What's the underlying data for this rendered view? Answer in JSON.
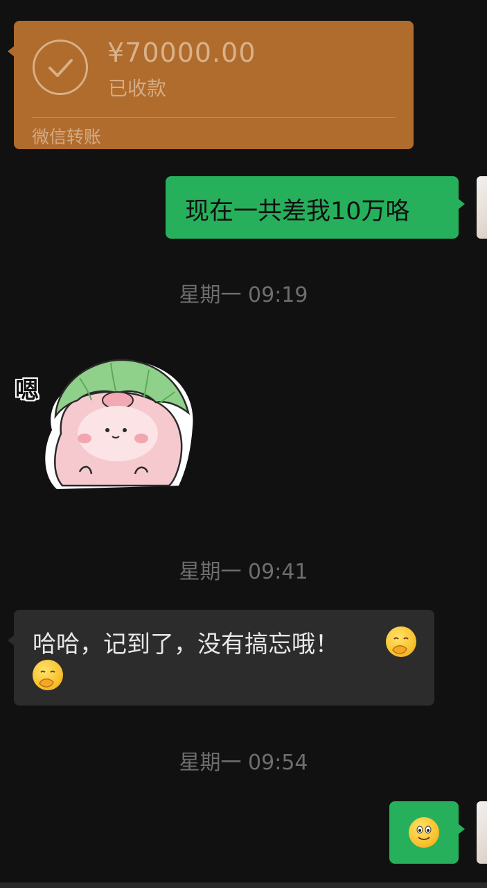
{
  "transfer": {
    "amount": "¥70000.00",
    "status": "已收款",
    "brand": "微信转账",
    "icon": "check-circle-icon"
  },
  "messages": {
    "sent_1": "现在一共差我10万咯",
    "timestamp_1": "星期一 09:19",
    "sticker_caption": "嗯",
    "timestamp_2": "星期一 09:41",
    "received_1": "哈哈，记到了，没有搞忘哦！",
    "timestamp_3": "星期一 09:54",
    "sent_2_emoji": "smiley-face-emoji"
  },
  "colors": {
    "transfer_bg": "#b06c2d",
    "sent_bg": "#27b05c",
    "received_bg": "#2c2c2c",
    "page_bg": "#111111"
  }
}
